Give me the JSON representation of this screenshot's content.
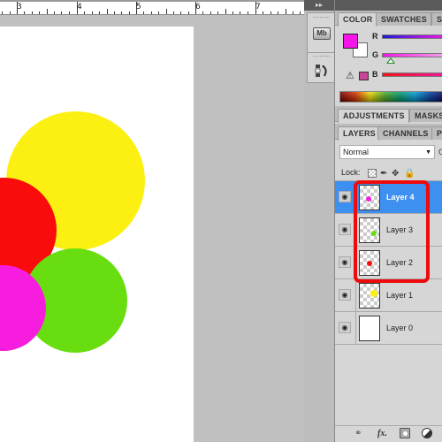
{
  "ruler": {
    "labels": [
      "3",
      "4",
      "5",
      "6",
      "7"
    ]
  },
  "canvas": {
    "shapes": [
      {
        "name": "yellow-circle",
        "color": "#fcf012"
      },
      {
        "name": "red-circle",
        "color": "#fa0c0c"
      },
      {
        "name": "green-circle",
        "color": "#68de10"
      },
      {
        "name": "magenta-circle",
        "color": "#f71ddf"
      }
    ]
  },
  "dock": {
    "collapse_icon": "double-right-arrow",
    "mini_bridge_label": "Mb"
  },
  "color_panel": {
    "tabs": [
      "COLOR",
      "SWATCHES",
      "S"
    ],
    "active_tab": "COLOR",
    "foreground_color": "#f316e6",
    "background_color": "#ffffff",
    "channels": [
      {
        "label": "R"
      },
      {
        "label": "G"
      },
      {
        "label": "B"
      }
    ],
    "gamut_warning_color": "#c94597"
  },
  "adjustments_panel": {
    "tabs": [
      "ADJUSTMENTS",
      "MASKS"
    ]
  },
  "layers_panel": {
    "tabs": [
      "LAYERS",
      "CHANNELS",
      "P"
    ],
    "active_tab": "LAYERS",
    "blend_mode": "Normal",
    "opacity_label_cut": "O",
    "lock_label": "Lock:",
    "layers": [
      {
        "name": "Layer 4",
        "selected": true,
        "visible": true,
        "dot_color": "#f71ddf"
      },
      {
        "name": "Layer 3",
        "selected": false,
        "visible": true,
        "dot_color": "#68de10"
      },
      {
        "name": "Layer 2",
        "selected": false,
        "visible": true,
        "dot_color": "#fa0c0c"
      },
      {
        "name": "Layer 1",
        "selected": false,
        "visible": true,
        "dot_color": "#fcf012"
      },
      {
        "name": "Layer 0",
        "selected": false,
        "visible": true,
        "dot_color": null
      }
    ],
    "footer_icons": [
      "link-icon",
      "fx-icon",
      "add-mask-icon",
      "adjustment-layer-icon"
    ],
    "fx_label": "fx."
  },
  "annotation": {
    "highlight_color": "#ee0b0b",
    "highlighted_layers": [
      "Layer 4",
      "Layer 3",
      "Layer 2"
    ]
  }
}
